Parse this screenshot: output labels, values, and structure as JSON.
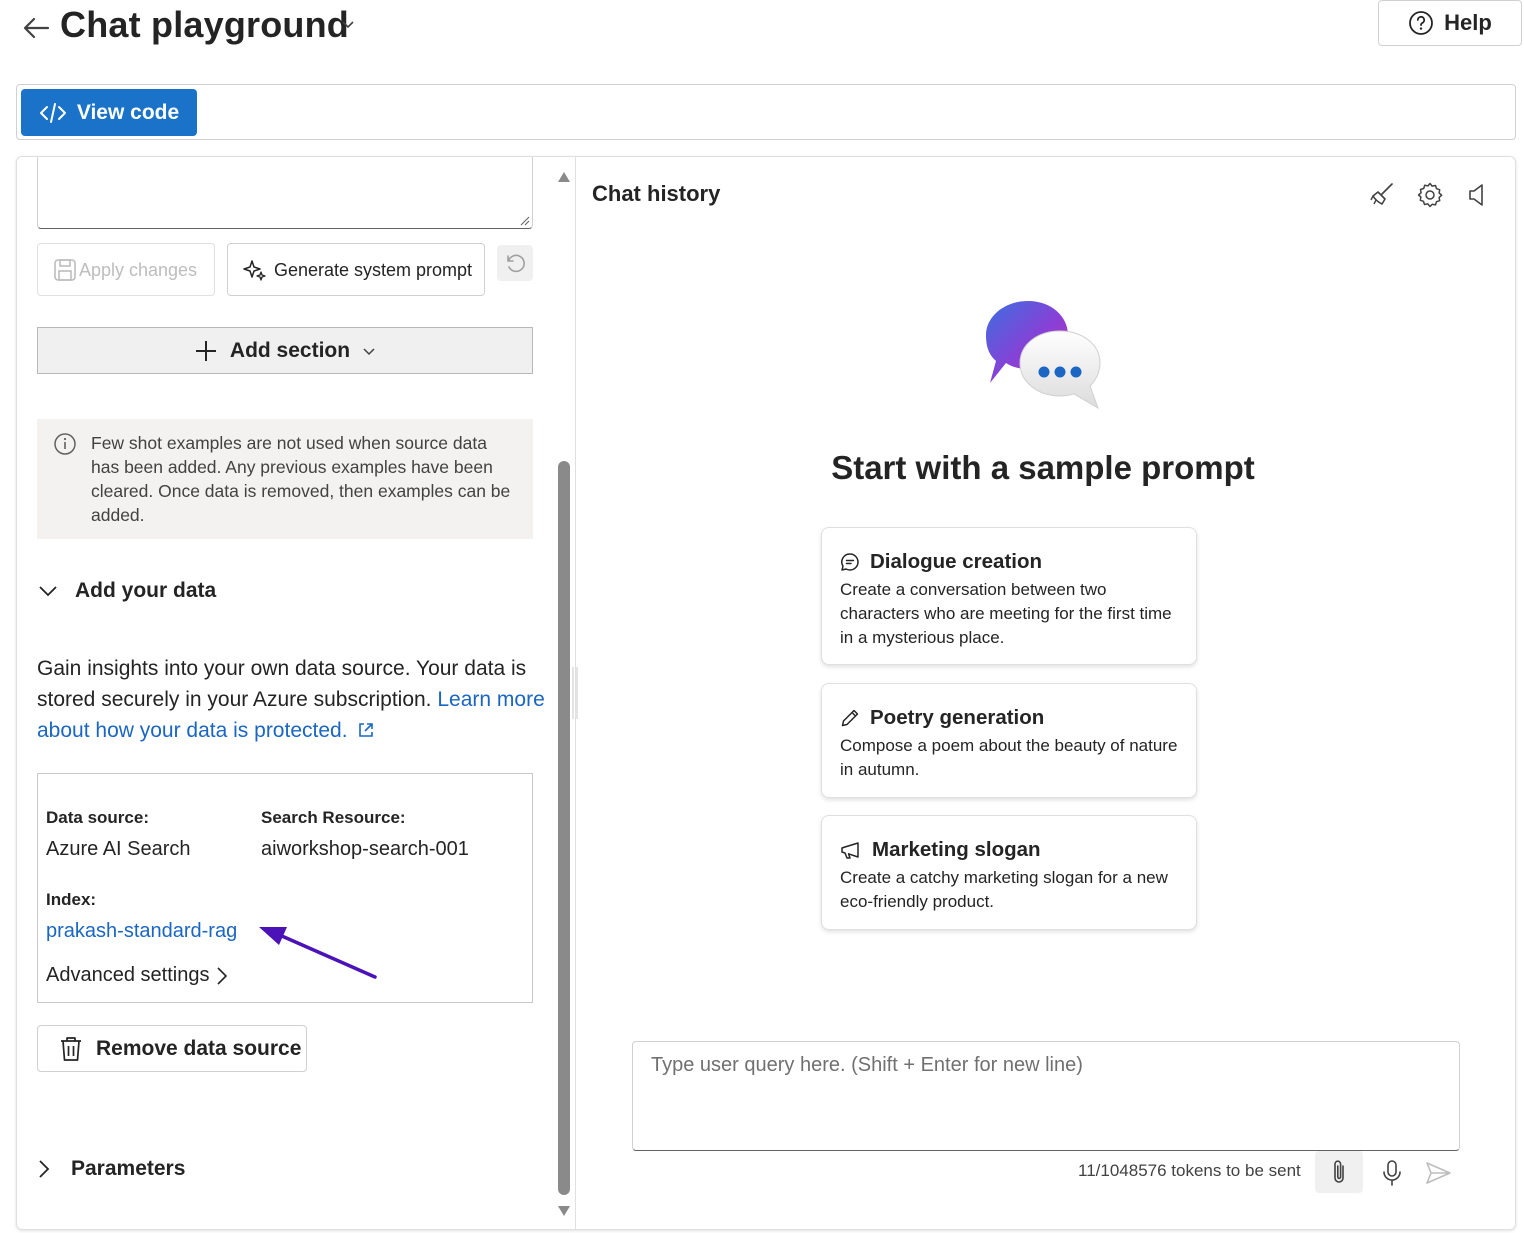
{
  "header": {
    "title": "Chat playground",
    "help_label": "Help"
  },
  "toolbar": {
    "view_code_label": "View code"
  },
  "setup": {
    "apply_changes_label": "Apply changes",
    "generate_prompt_label": "Generate system prompt",
    "add_section_label": "Add section",
    "info_text": "Few shot examples are not used when source data has been added. Any previous examples have been cleared. Once data is removed, then examples can be added.",
    "add_your_data_label": "Add your data",
    "insight_text": "Gain insights into your own data source. Your data is stored securely in your Azure subscription. ",
    "insight_link": "Learn more about how your data is protected.",
    "data_source_label": "Data source:",
    "data_source_value": "Azure AI Search",
    "search_resource_label": "Search Resource:",
    "search_resource_value": "aiworkshop-search-001",
    "index_label": "Index:",
    "index_value": "prakash-standard-rag",
    "advanced_settings_label": "Advanced settings",
    "remove_data_source_label": "Remove data source",
    "parameters_label": "Parameters"
  },
  "chat": {
    "history_title": "Chat history",
    "start_title": "Start with a sample prompt",
    "samples": [
      {
        "icon": "chat-bubble-icon",
        "title": "Dialogue creation",
        "desc": "Create a conversation between two characters who are meeting for the first time in a mysterious place."
      },
      {
        "icon": "pen-icon",
        "title": "Poetry generation",
        "desc": "Compose a poem about the beauty of nature in autumn."
      },
      {
        "icon": "megaphone-icon",
        "title": "Marketing slogan",
        "desc": "Create a catchy marketing slogan for a new eco-friendly product."
      }
    ],
    "input_placeholder": "Type user query here. (Shift + Enter for new line)",
    "tokens_text": "11/1048576 tokens to be sent"
  },
  "colors": {
    "accent": "#1a73c9",
    "link": "#1a66c2",
    "annotation_arrow": "#4b12b8"
  }
}
